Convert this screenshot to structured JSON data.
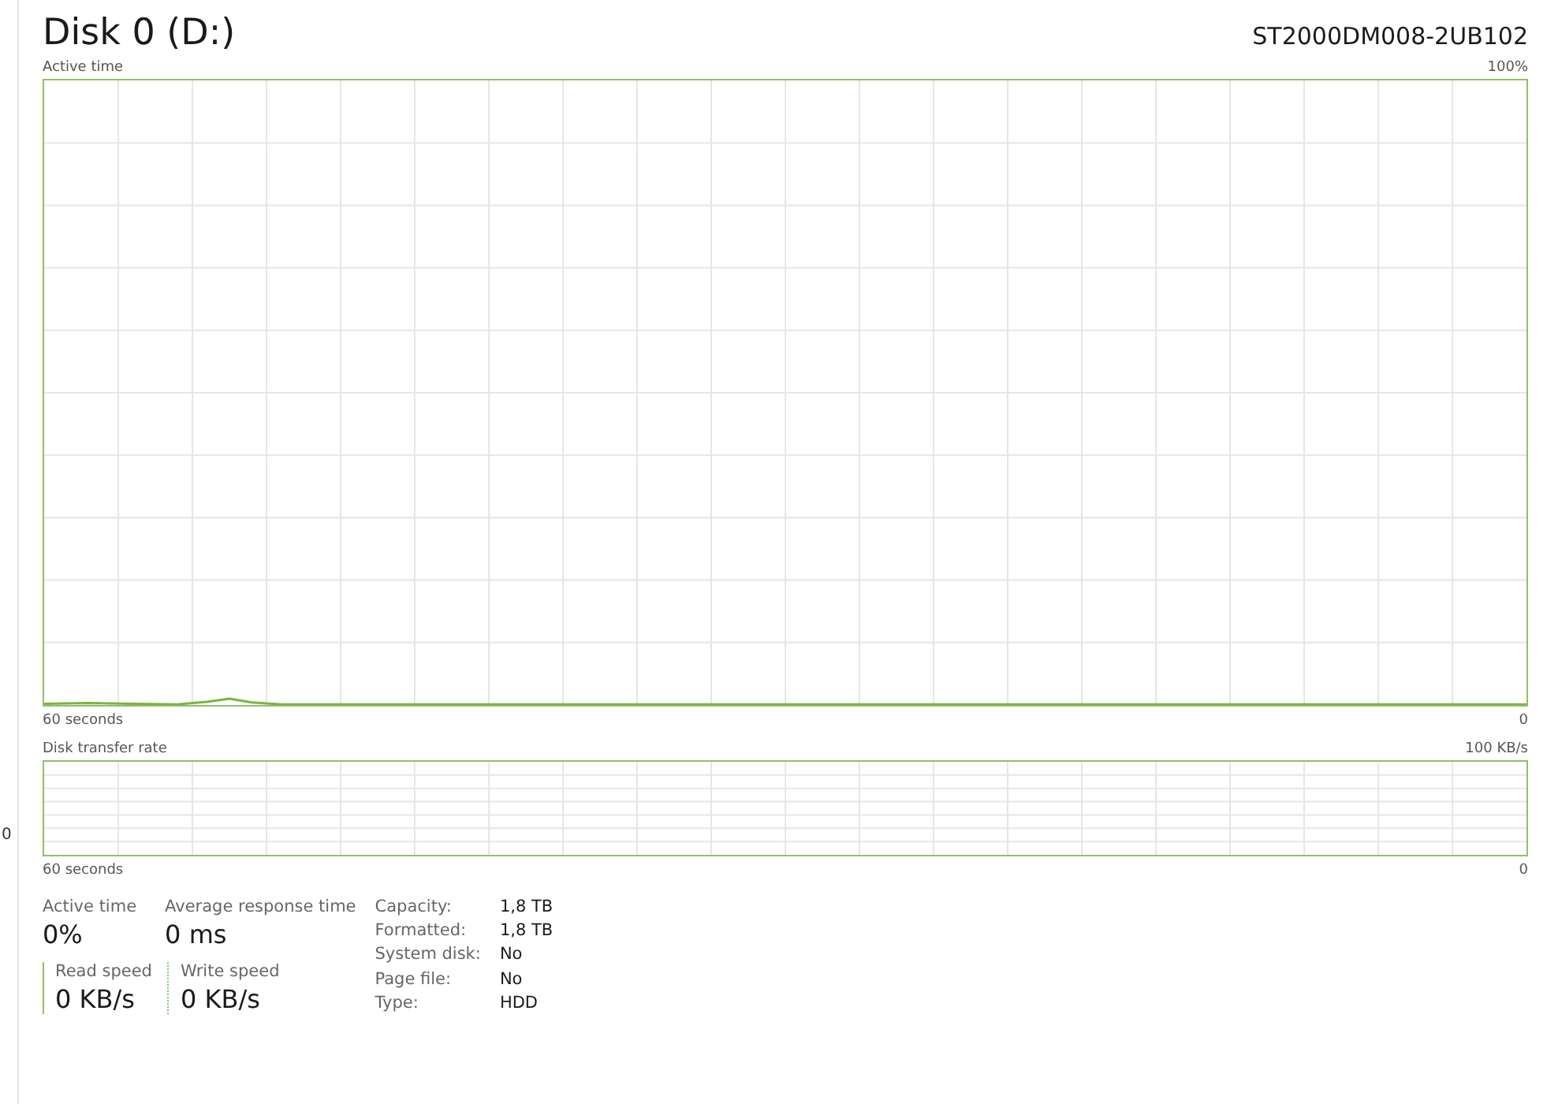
{
  "sidebar_fragment": "0",
  "header": {
    "title": "Disk 0 (D:)",
    "model": "ST2000DM008-2UB102"
  },
  "active_chart": {
    "title": "Active time",
    "max_label": "100%",
    "time_label": "60 seconds",
    "min_label": "0"
  },
  "transfer_chart": {
    "title": "Disk transfer rate",
    "max_label": "100 KB/s",
    "time_label": "60 seconds",
    "min_label": "0"
  },
  "stats": [
    {
      "label": "Active time",
      "value": "0%"
    },
    {
      "label": "Average response time",
      "value": "0 ms"
    }
  ],
  "speeds": [
    {
      "label": "Read speed",
      "value": "0 KB/s",
      "kind": "solid"
    },
    {
      "label": "Write speed",
      "value": "0 KB/s",
      "kind": "dotted"
    }
  ],
  "properties": [
    {
      "label": "Capacity:",
      "value": "1,8 TB"
    },
    {
      "label": "Formatted:",
      "value": "1,8 TB"
    },
    {
      "label": "System disk:",
      "value": "No"
    },
    {
      "label": "Page file:",
      "value": "No"
    },
    {
      "label": "Type:",
      "value": "HDD"
    }
  ]
}
